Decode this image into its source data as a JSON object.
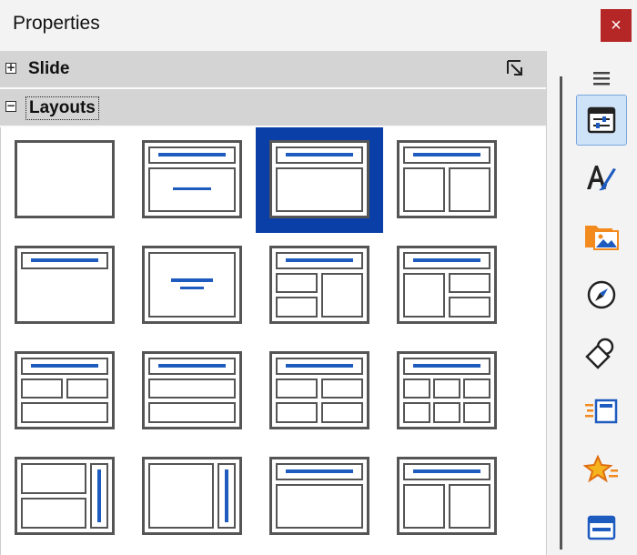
{
  "window": {
    "title": "Properties",
    "close_glyph": "×"
  },
  "sections": [
    {
      "label": "Slide",
      "expander": "+",
      "expanded": false
    },
    {
      "label": "Layouts",
      "expander": "−",
      "expanded": true
    }
  ],
  "more_options_icon": "dialog-launcher-icon",
  "layouts": {
    "selected": "Title, Content",
    "items": [
      "Blank Slide",
      "Title Slide",
      "Title, Content",
      "Title and 2 Content",
      "Title Only",
      "Centered Text",
      "Title, 2 Content and Content",
      "Title, Content and 2 Content",
      "Title, 2 Content over Content",
      "Title, Content over Content",
      "Title, 4 Content",
      "Title, 6 Content",
      "Vertical Title, Text, Chart",
      "Vertical Title, Vertical Text",
      "Title, Vertical Text",
      "Title, 2 Vertical Text, Clipart"
    ]
  },
  "sidebar": {
    "menu_icon": "hamburger-menu-icon",
    "tabs": [
      "Properties",
      "Styles",
      "Gallery",
      "Navigator",
      "Shapes",
      "Slide Transition",
      "Animation",
      "Master Slides"
    ],
    "active": "Properties"
  },
  "colors": {
    "accent_blue": "#1e5bbf",
    "selection": "#0b3fa8",
    "close_red": "#b52727"
  }
}
